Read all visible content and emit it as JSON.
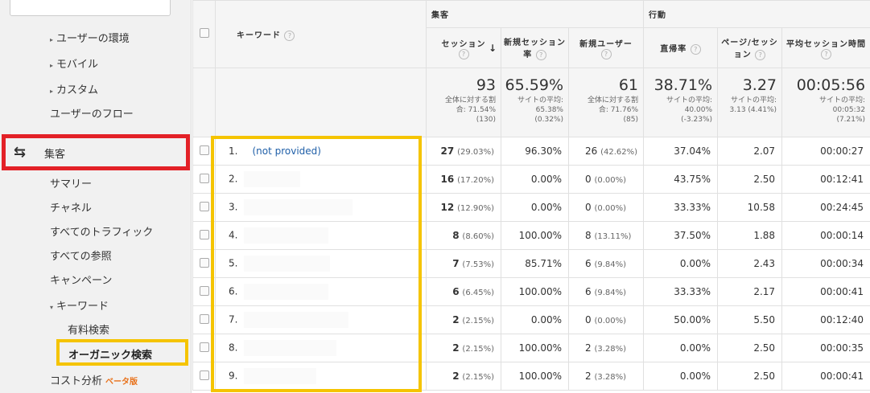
{
  "sidebar": {
    "items": [
      {
        "label": "ユーザーの環境",
        "tri": "▸"
      },
      {
        "label": "モバイル",
        "tri": "▸"
      },
      {
        "label": "カスタム",
        "tri": "▸"
      },
      {
        "label": "ユーザーのフロー",
        "tri": ""
      }
    ],
    "acquisition": "集客",
    "acq_sub": [
      "サマリー",
      "チャネル",
      "すべてのトラフィック",
      "すべての参照",
      "キャンペーン"
    ],
    "keyword": "キーワード",
    "keyword_tri": "▾",
    "paid": "有料検索",
    "organic": "オーガニック検索",
    "cost": "コスト分析",
    "beta": "ベータ版"
  },
  "table": {
    "keyword_header": "キーワード",
    "group_acq": "集客",
    "group_beh": "行動",
    "columns": [
      "セッション",
      "新規セッション率",
      "新規ユーザー",
      "直帰率",
      "ページ/セッション",
      "平均セッション時間"
    ],
    "sort_arrow": "↓",
    "summary": [
      {
        "big": "93",
        "sub": [
          "全体に対する割",
          "合: 71.54%",
          "(130)"
        ]
      },
      {
        "big": "65.59%",
        "sub": [
          "サイトの平均:",
          "65.38%",
          "(0.32%)"
        ]
      },
      {
        "big": "61",
        "sub": [
          "全体に対する割",
          "合: 71.76%",
          "(85)"
        ]
      },
      {
        "big": "38.71%",
        "sub": [
          "サイトの平均:",
          "40.00%",
          "(-3.23%)"
        ]
      },
      {
        "big": "3.27",
        "sub": [
          "サイトの平均:",
          "3.13 (4.41%)",
          ""
        ]
      },
      {
        "big": "00:05:56",
        "sub": [
          "サイトの平均:",
          "00:05:32",
          "(7.21%)"
        ]
      }
    ],
    "rows": [
      {
        "idx": "1.",
        "kw": "(not provided)",
        "s": "27",
        "sp": "(29.03%)",
        "nsr": "96.30%",
        "nu": "26",
        "nup": "(42.62%)",
        "br": "37.04%",
        "pps": "2.07",
        "t": "00:00:27"
      },
      {
        "idx": "2.",
        "kw": "",
        "s": "16",
        "sp": "(17.20%)",
        "nsr": "0.00%",
        "nu": "0",
        "nup": "(0.00%)",
        "br": "43.75%",
        "pps": "2.50",
        "t": "00:12:41"
      },
      {
        "idx": "3.",
        "kw": "",
        "s": "12",
        "sp": "(12.90%)",
        "nsr": "0.00%",
        "nu": "0",
        "nup": "(0.00%)",
        "br": "33.33%",
        "pps": "10.58",
        "t": "00:24:45"
      },
      {
        "idx": "4.",
        "kw": "",
        "s": "8",
        "sp": "(8.60%)",
        "nsr": "100.00%",
        "nu": "8",
        "nup": "(13.11%)",
        "br": "37.50%",
        "pps": "1.88",
        "t": "00:00:14"
      },
      {
        "idx": "5.",
        "kw": "",
        "s": "7",
        "sp": "(7.53%)",
        "nsr": "85.71%",
        "nu": "6",
        "nup": "(9.84%)",
        "br": "0.00%",
        "pps": "2.43",
        "t": "00:00:34"
      },
      {
        "idx": "6.",
        "kw": "",
        "s": "6",
        "sp": "(6.45%)",
        "nsr": "100.00%",
        "nu": "6",
        "nup": "(9.84%)",
        "br": "33.33%",
        "pps": "2.17",
        "t": "00:00:41"
      },
      {
        "idx": "7.",
        "kw": "",
        "s": "2",
        "sp": "(2.15%)",
        "nsr": "0.00%",
        "nu": "0",
        "nup": "(0.00%)",
        "br": "50.00%",
        "pps": "5.50",
        "t": "00:12:40"
      },
      {
        "idx": "8.",
        "kw": "",
        "s": "2",
        "sp": "(2.15%)",
        "nsr": "100.00%",
        "nu": "2",
        "nup": "(3.28%)",
        "br": "0.00%",
        "pps": "2.50",
        "t": "00:00:35"
      },
      {
        "idx": "9.",
        "kw": "",
        "s": "2",
        "sp": "(2.15%)",
        "nsr": "100.00%",
        "nu": "2",
        "nup": "(3.28%)",
        "br": "0.00%",
        "pps": "2.50",
        "t": "00:00:41"
      }
    ]
  },
  "colors": {
    "red_highlight": "#e32127",
    "yellow_highlight": "#f5c400",
    "link": "#1f5fa8",
    "beta": "#e8711a"
  }
}
